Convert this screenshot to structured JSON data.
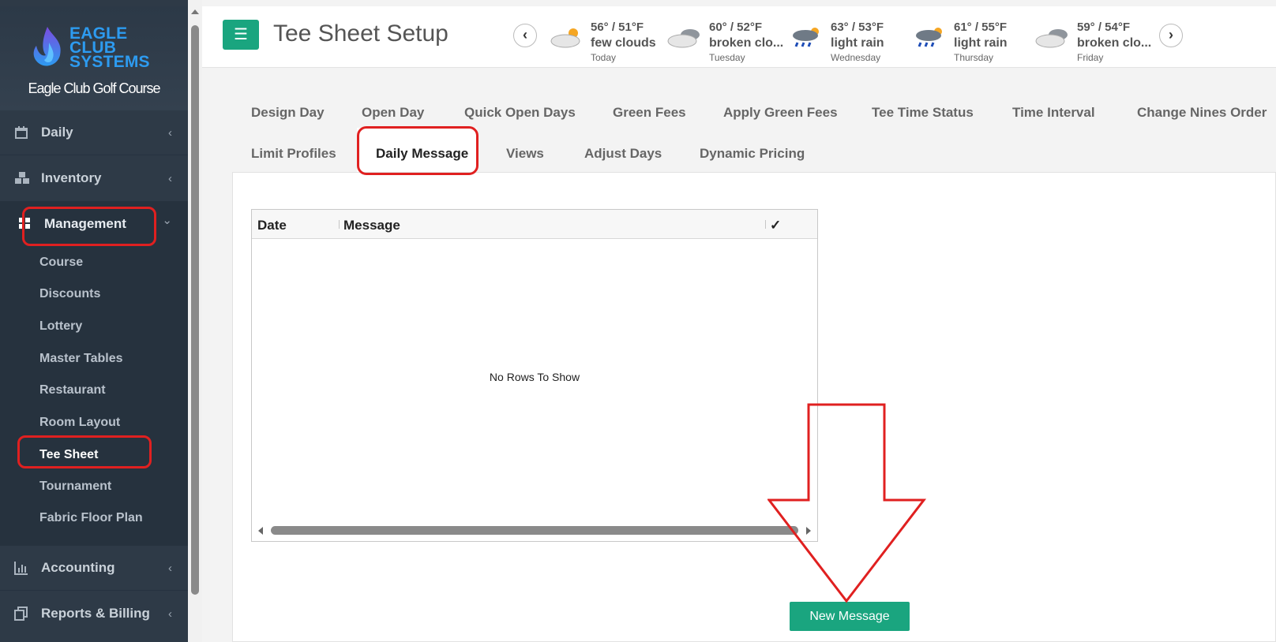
{
  "brand": {
    "logo_line1": "EAGLE",
    "logo_line2": "CLUB",
    "logo_line3": "SYSTEMS",
    "club_name": "Eagle Club Golf Course"
  },
  "sidebar": {
    "items": [
      {
        "label": "Daily",
        "icon": "calendar-icon",
        "chevron": "‹"
      },
      {
        "label": "Inventory",
        "icon": "cubes-icon",
        "chevron": "‹"
      },
      {
        "label": "Management",
        "icon": "grid-icon",
        "chevron": "⌄"
      },
      {
        "label": "Accounting",
        "icon": "bar-chart-icon",
        "chevron": "‹"
      },
      {
        "label": "Reports & Billing",
        "icon": "copy-icon",
        "chevron": "‹"
      }
    ],
    "management_sub": [
      "Course",
      "Discounts",
      "Lottery",
      "Master Tables",
      "Restaurant",
      "Room Layout",
      "Tee Sheet",
      "Tournament",
      "Fabric Floor Plan"
    ],
    "active_sub": "Tee Sheet"
  },
  "header": {
    "menu_icon": "☰",
    "title": "Tee Sheet Setup"
  },
  "weather": {
    "prev": "‹",
    "next": "›",
    "days": [
      {
        "temp": "56° / 51°F",
        "cond": "few clouds",
        "day": "Today",
        "icon": "partly-sunny-icon"
      },
      {
        "temp": "60° / 52°F",
        "cond": "broken clo...",
        "day": "Tuesday",
        "icon": "clouds-icon"
      },
      {
        "temp": "63° / 53°F",
        "cond": "light rain",
        "day": "Wednesday",
        "icon": "rain-sun-icon"
      },
      {
        "temp": "61° / 55°F",
        "cond": "light rain",
        "day": "Thursday",
        "icon": "rain-sun-icon"
      },
      {
        "temp": "59° / 54°F",
        "cond": "broken clo...",
        "day": "Friday",
        "icon": "clouds-icon"
      }
    ]
  },
  "tabs": {
    "row1": [
      "Design Day",
      "Open Day",
      "Quick Open Days",
      "Green Fees",
      "Apply Green Fees",
      "Tee Time Status",
      "Time Interval",
      "Change Nines Order"
    ],
    "row2": [
      "Limit Profiles",
      "Daily Message",
      "Views",
      "Adjust Days",
      "Dynamic Pricing"
    ],
    "active": "Daily Message"
  },
  "grid": {
    "columns": [
      "Date",
      "Message",
      "✓"
    ],
    "empty_text": "No Rows To Show"
  },
  "actions": {
    "new_message": "New Message"
  },
  "colors": {
    "accent": "#1aa57f",
    "sidebar": "#2e3a47",
    "highlight": "#e02020"
  }
}
